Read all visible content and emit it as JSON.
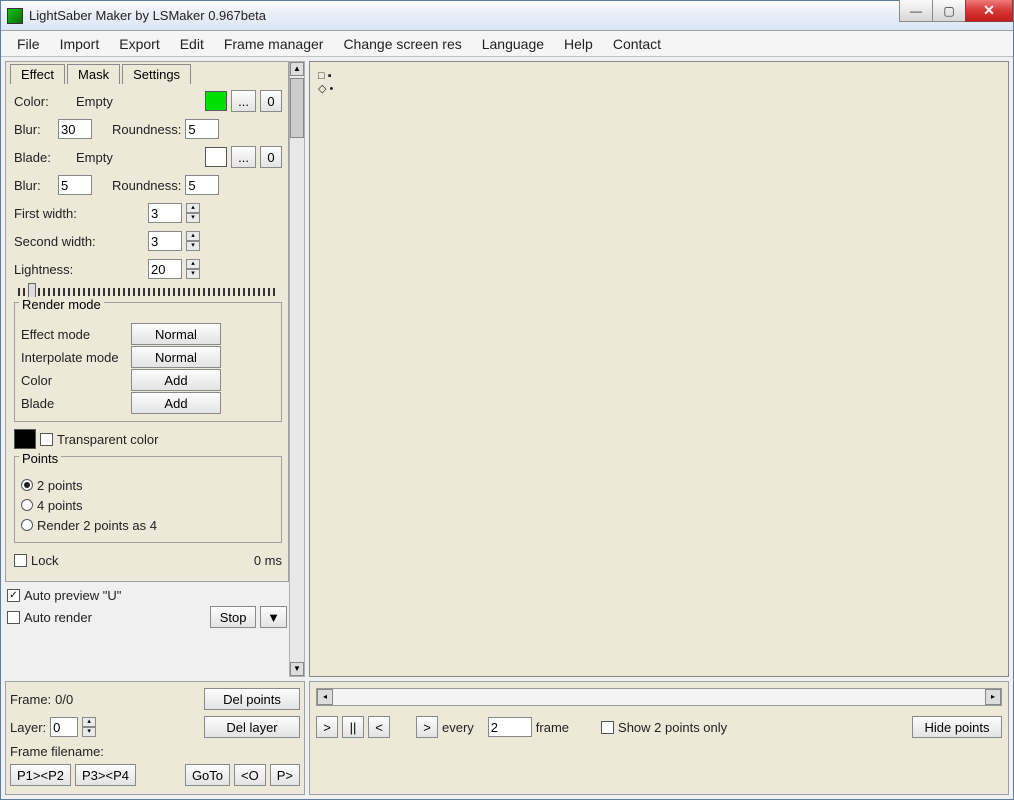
{
  "title": "LightSaber Maker by LSMaker 0.967beta",
  "menu": [
    "File",
    "Import",
    "Export",
    "Edit",
    "Frame manager",
    "Change screen res",
    "Language",
    "Help",
    "Contact"
  ],
  "tabs": [
    "Effect",
    "Mask",
    "Settings"
  ],
  "effect": {
    "color_label": "Color:",
    "color_state": "Empty",
    "color_swatch": "#00e000",
    "color_ellipsis": "...",
    "color_zero": "0",
    "blur1_label": "Blur:",
    "blur1_value": "30",
    "roundness1_label": "Roundness:",
    "roundness1_value": "5",
    "blade_label": "Blade:",
    "blade_state": "Empty",
    "blade_swatch": "#ffffff",
    "blade_ellipsis": "...",
    "blade_zero": "0",
    "blur2_label": "Blur:",
    "blur2_value": "5",
    "roundness2_label": "Roundness:",
    "roundness2_value": "5",
    "first_width_label": "First width:",
    "first_width_value": "3",
    "second_width_label": "Second width:",
    "second_width_value": "3",
    "lightness_label": "Lightness:",
    "lightness_value": "20"
  },
  "rendermode": {
    "title": "Render mode",
    "effect_mode_label": "Effect mode",
    "effect_mode_value": "Normal",
    "interpolate_label": "Interpolate mode",
    "interpolate_value": "Normal",
    "color_label": "Color",
    "color_value": "Add",
    "blade_label": "Blade",
    "blade_value": "Add"
  },
  "transparent": {
    "swatch": "#000000",
    "label": "Transparent color"
  },
  "points": {
    "title": "Points",
    "opt1": "2 points",
    "opt2": "4 points",
    "opt3": "Render 2 points as 4",
    "lock": "Lock",
    "timing": "0 ms"
  },
  "preview": {
    "auto_preview": "Auto preview \"U\"",
    "auto_render": "Auto render",
    "stop": "Stop"
  },
  "bottomleft": {
    "frame_label": "Frame:",
    "frame_value": "0/0",
    "layer_label": "Layer:",
    "layer_value": "0",
    "del_points": "Del points",
    "del_layer": "Del layer",
    "filename_label": "Frame filename:",
    "p1p2": "P1><P2",
    "p3p4": "P3><P4",
    "goto": "GoTo",
    "angleO": "<O",
    "p_btn": "P>"
  },
  "bottomright": {
    "next": ">",
    "pause": "||",
    "prev": "<",
    "step": ">",
    "every": "every",
    "every_value": "2",
    "frame_word": "frame",
    "show2": "Show 2 points only",
    "hide_points": "Hide points"
  }
}
